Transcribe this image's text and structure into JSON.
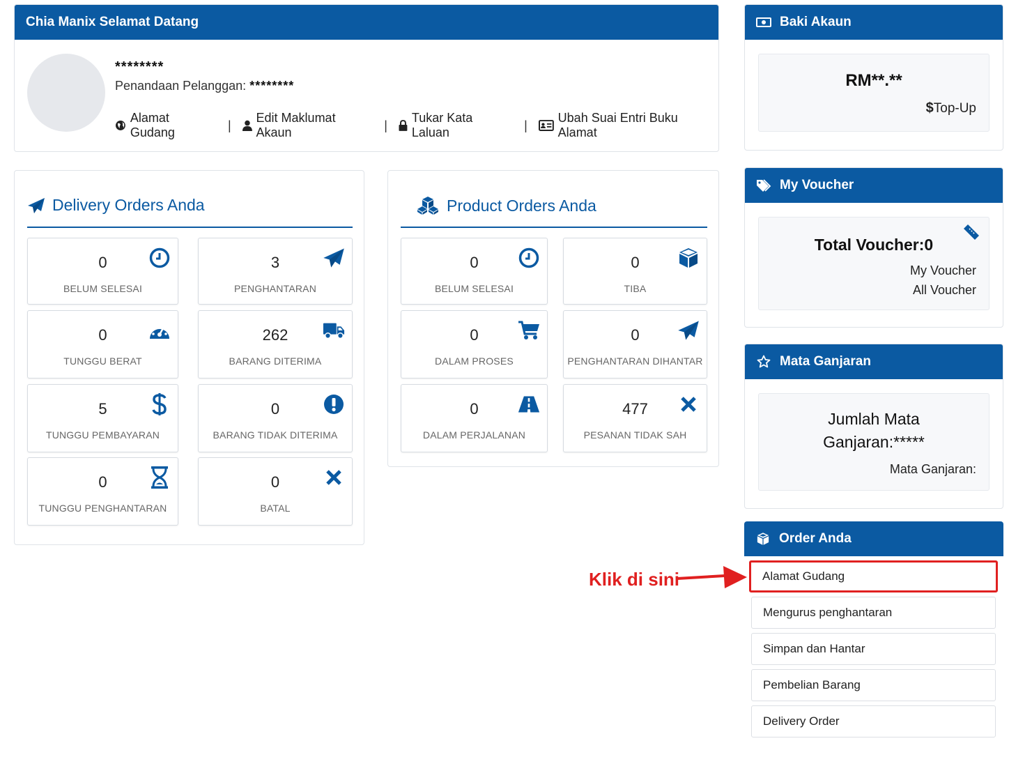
{
  "welcome": {
    "title": "Chia Manix Selamat Datang",
    "masked_name": "********",
    "customer_id_label": "Penandaan Pelanggan:",
    "customer_id_value": "********",
    "links": [
      "Alamat Gudang",
      "Edit Maklumat Akaun",
      "Tukar Kata Laluan",
      "Ubah Suai Entri Buku Alamat"
    ],
    "separator": "|"
  },
  "delivery": {
    "title": "Delivery Orders Anda",
    "tiles": [
      {
        "value": "0",
        "label": "BELUM SELESAI",
        "icon": "clock-icon"
      },
      {
        "value": "3",
        "label": "PENGHANTARAN",
        "icon": "paper-plane-icon"
      },
      {
        "value": "0",
        "label": "TUNGGU BERAT",
        "icon": "gauge-icon"
      },
      {
        "value": "262",
        "label": "BARANG DITERIMA",
        "icon": "truck-icon"
      },
      {
        "value": "5",
        "label": "TUNGGU PEMBAYARAN",
        "icon": "dollar-icon"
      },
      {
        "value": "0",
        "label": "BARANG TIDAK DITERIMA",
        "icon": "exclamation-circle-icon"
      },
      {
        "value": "0",
        "label": "TUNGGU PENGHANTARAN",
        "icon": "hourglass-icon"
      },
      {
        "value": "0",
        "label": "BATAL",
        "icon": "x-icon"
      }
    ]
  },
  "product": {
    "title": "Product Orders Anda",
    "tiles": [
      {
        "value": "0",
        "label": "BELUM SELESAI",
        "icon": "clock-icon"
      },
      {
        "value": "0",
        "label": "TIBA",
        "icon": "cube-icon"
      },
      {
        "value": "0",
        "label": "DALAM PROSES",
        "icon": "cart-icon"
      },
      {
        "value": "0",
        "label": "PENGHANTARAN DIHANTAR",
        "icon": "paper-plane-icon"
      },
      {
        "value": "0",
        "label": "DALAM PERJALANAN",
        "icon": "road-icon"
      },
      {
        "value": "477",
        "label": "PESANAN TIDAK SAH",
        "icon": "x-icon"
      }
    ]
  },
  "balance": {
    "title": "Baki Akaun",
    "amount": "RM**.**",
    "topup_symbol": "$",
    "topup_label": "Top-Up"
  },
  "voucher": {
    "title": "My Voucher",
    "total": "Total Voucher:0",
    "my_voucher": "My Voucher",
    "all_voucher": "All Voucher"
  },
  "points": {
    "title": "Mata Ganjaran",
    "total_line1": "Jumlah Mata",
    "total_line2": "Ganjaran:*****",
    "sub": "Mata Ganjaran:"
  },
  "orders_menu": {
    "title": "Order Anda",
    "items": [
      "Alamat Gudang",
      "Mengurus penghantaran",
      "Simpan dan Hantar",
      "Pembelian Barang",
      "Delivery Order"
    ],
    "highlighted_index": 0
  },
  "annotation": {
    "text": "Klik di sini",
    "color": "#e02020"
  },
  "colors": {
    "primary": "#0b5aa2",
    "highlight": "#e02020"
  }
}
